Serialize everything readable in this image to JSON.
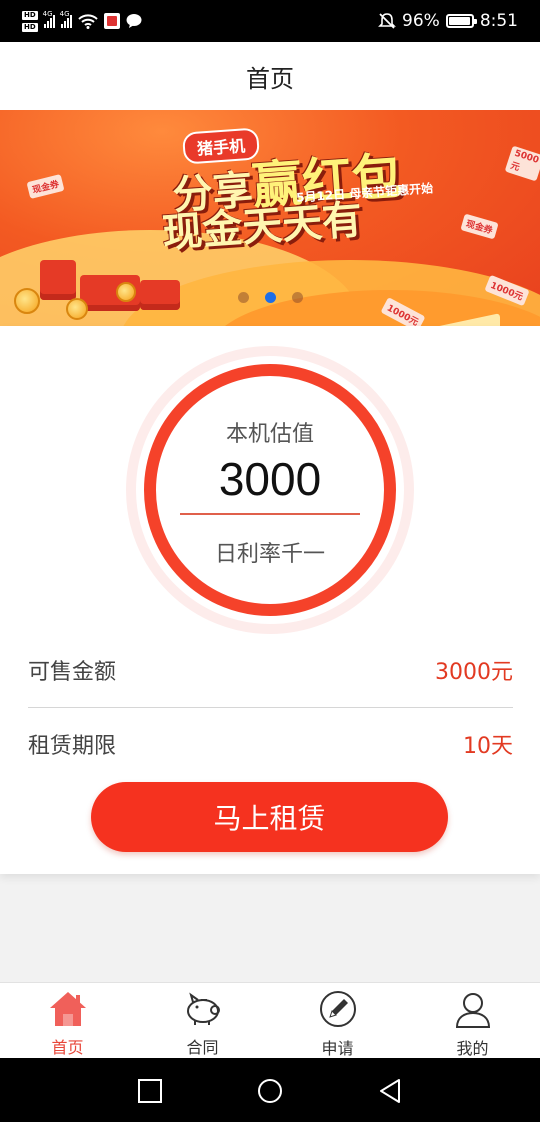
{
  "status_bar": {
    "left_chips": [
      "HD",
      "HD"
    ],
    "network_labels": [
      "4G",
      "4G"
    ],
    "battery_percent": "96%",
    "battery_level": 0.96,
    "time": "8:51"
  },
  "header": {
    "title": "首页"
  },
  "banner": {
    "tag": "猪手机",
    "headline_line1_part1": "分享",
    "headline_line1_part2": "赢红包",
    "headline_line2": "现金天天有",
    "subline": "5月12日 母亲节钜惠开始",
    "bill_labels": [
      "现金券",
      "5000元",
      "现金券",
      "1000元",
      "1000元"
    ],
    "carousel": {
      "count": 3,
      "active_index": 1
    }
  },
  "valuation": {
    "label": "本机估值",
    "value": "3000",
    "rate_label": "日利率千一"
  },
  "details": [
    {
      "key": "可售金额",
      "value": "3000元"
    },
    {
      "key": "租赁期限",
      "value": "10天"
    }
  ],
  "cta": {
    "label": "马上租赁"
  },
  "bottom_nav": {
    "items": [
      {
        "label": "首页",
        "icon": "home-icon",
        "active": true
      },
      {
        "label": "合同",
        "icon": "piggy-bank-icon",
        "active": false
      },
      {
        "label": "申请",
        "icon": "pencil-circle-icon",
        "active": false
      },
      {
        "label": "我的",
        "icon": "user-icon",
        "active": false
      }
    ]
  },
  "colors": {
    "accent": "#f5321f",
    "value_text": "#e23a22",
    "active_nav": "#e8473a"
  }
}
